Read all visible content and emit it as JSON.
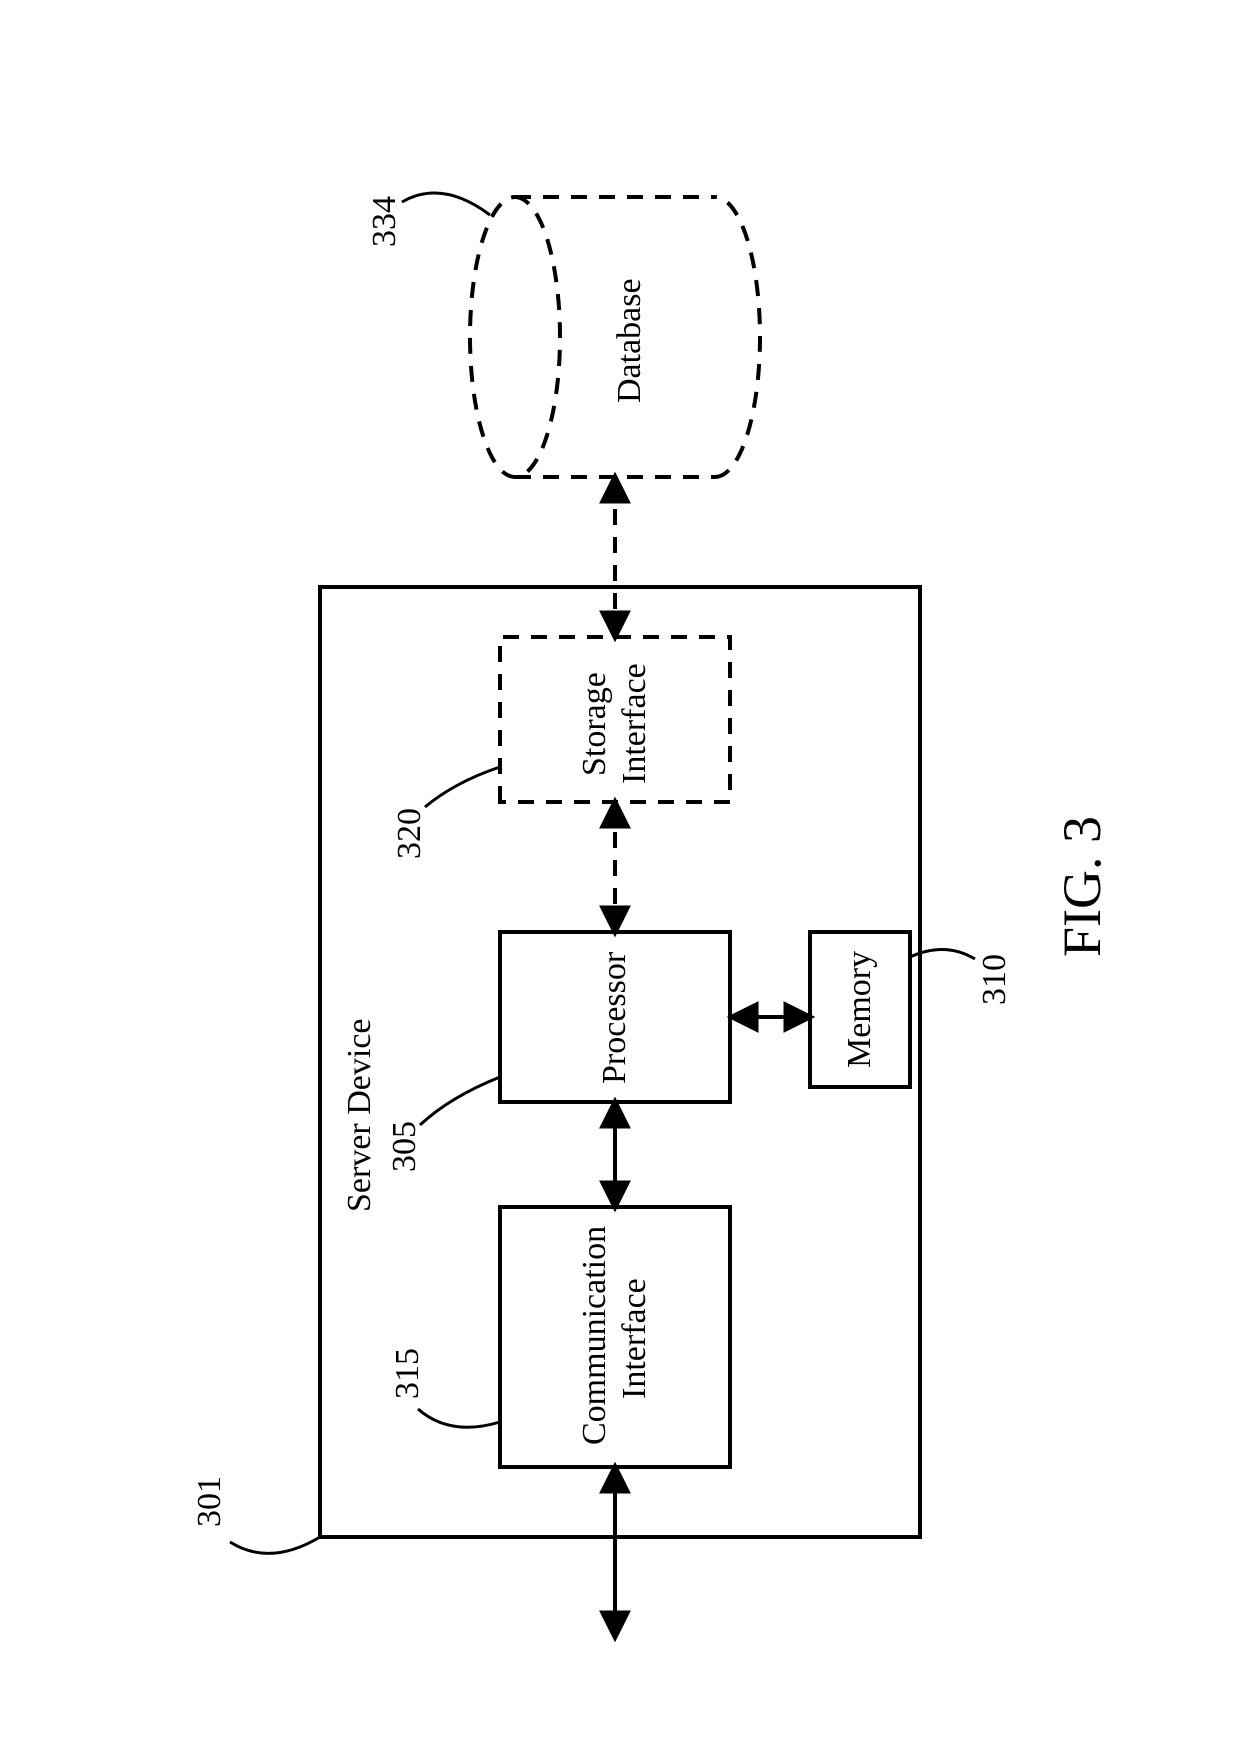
{
  "figure": {
    "caption": "FIG. 3",
    "container": {
      "title": "Server Device",
      "ref": "301"
    },
    "blocks": {
      "communication_interface": {
        "line1": "Communication",
        "line2": "Interface",
        "ref": "315"
      },
      "processor": {
        "label": "Processor",
        "ref": "305"
      },
      "memory": {
        "label": "Memory",
        "ref": "310"
      },
      "storage_interface": {
        "line1": "Storage",
        "line2": "Interface",
        "ref": "320"
      },
      "database": {
        "label": "Database",
        "ref": "334"
      }
    }
  }
}
